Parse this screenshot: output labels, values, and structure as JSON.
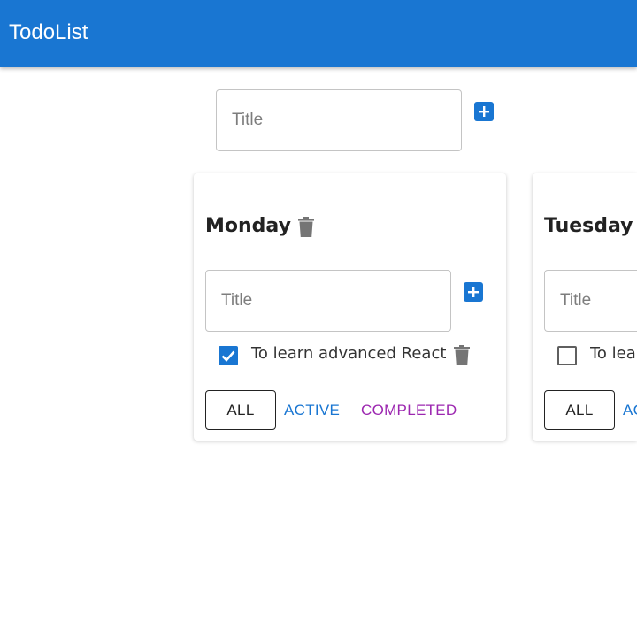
{
  "app": {
    "title": "TodoList"
  },
  "new_list": {
    "placeholder": "Title"
  },
  "lists": [
    {
      "title": "Monday",
      "input_placeholder": "Title",
      "tasks": [
        {
          "label": "To learn advanced React",
          "done": true
        }
      ],
      "filters": {
        "all": "ALL",
        "active": "ACTIVE",
        "completed": "COMPLETED"
      }
    },
    {
      "title": "Tuesday",
      "input_placeholder": "Title",
      "tasks": [
        {
          "label": "To lea",
          "done": false
        }
      ],
      "filters": {
        "all": "ALL",
        "active": "AC"
      }
    }
  ],
  "colors": {
    "primary": "#1976d2",
    "secondary": "#9c27b0",
    "icon_gray": "#757575"
  }
}
